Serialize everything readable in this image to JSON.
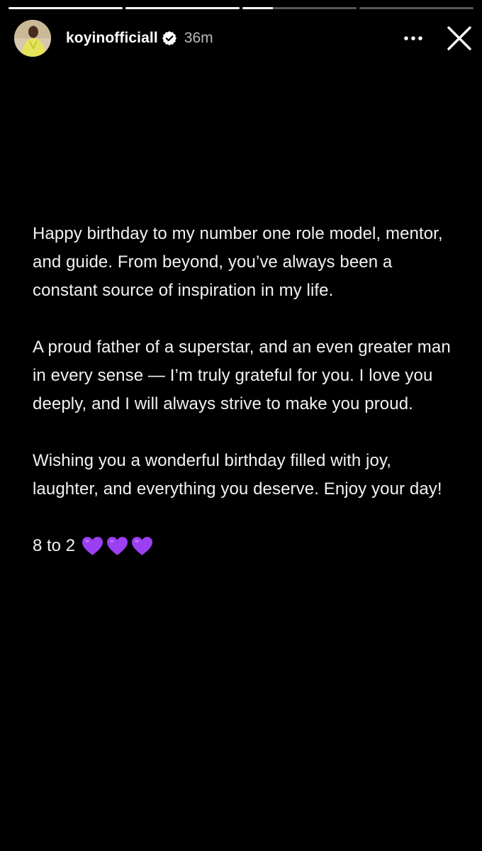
{
  "story": {
    "progress": [
      1,
      1,
      0.27,
      0
    ],
    "user": {
      "username": "koyinofficiall",
      "verified": true,
      "time_ago": "36m",
      "avatar_icon": "profile-photo"
    },
    "actions": {
      "more_icon": "more-horizontal-icon",
      "close_icon": "close-icon"
    },
    "text": {
      "paragraph_1": "Happy birthday to my number one role model, mentor, and guide. From beyond, you’ve always been a constant source of inspiration in my life.",
      "paragraph_2": "A proud father of a superstar, and an even greater man in every sense — I’m truly grateful for you. I love you deeply, and I will always strive to make you proud.",
      "paragraph_3": "Wishing you a wonderful birthday filled with joy, laughter, and everything you deserve. Enjoy your day!",
      "sign_off": "8 to 2",
      "hearts": [
        "💜",
        "💜",
        "💜"
      ]
    }
  },
  "colors": {
    "background": "#000000",
    "heart": "#9b3ff2",
    "verified_badge": "#ffffff"
  }
}
